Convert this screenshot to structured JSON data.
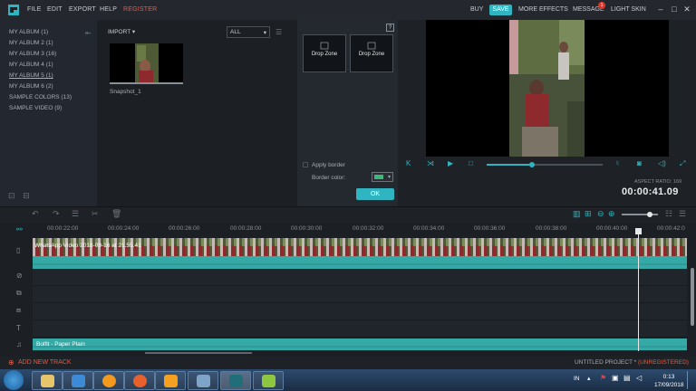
{
  "menu": {
    "file": "FILE",
    "edit": "EDIT",
    "export": "EXPORT",
    "help": "HELP",
    "register": "REGISTER",
    "buy": "BUY",
    "save": "SAVE",
    "more_effects": "MORE EFFECTS",
    "message": "MESSAGE",
    "message_count": "1",
    "light_skin": "LIGHT SKIN"
  },
  "library": {
    "albums": [
      {
        "label": "MY ALBUM (1)"
      },
      {
        "label": "MY ALBUM 2 (1)"
      },
      {
        "label": "MY ALBUM 3 (16)"
      },
      {
        "label": "MY ALBUM 4 (1)"
      },
      {
        "label": "MY ALBUM 5 (1)"
      },
      {
        "label": "MY ALBUM 6 (2)"
      },
      {
        "label": "SAMPLE COLORS (13)"
      },
      {
        "label": "SAMPLE VIDEO (9)"
      }
    ]
  },
  "media": {
    "import_label": "IMPORT",
    "filter_value": "ALL",
    "thumb_label": "Snapshot_1"
  },
  "transition": {
    "help": "?",
    "dropzone1": "Drop Zone",
    "dropzone2": "Drop Zone",
    "apply_border": "Apply border",
    "border_color_label": "Border color:",
    "border_color": "#3cb878",
    "ok": "OK"
  },
  "preview": {
    "aspect_ratio": "ASPECT RATIO: 169",
    "timecode": "00:00:41.09",
    "progress": 0.39
  },
  "timeline": {
    "ticks": [
      "00:00:22:00",
      "00:00:24:00",
      "00:00:26:00",
      "00:00:28:00",
      "00:00:30:00",
      "00:00:32:00",
      "00:00:34:00",
      "00:00:36:00",
      "00:00:38:00",
      "00:00:40:00",
      "00:00:42:0"
    ],
    "video_clip_label": "WhatsApp Video 2018-09-16 at 21.55.41",
    "music_clip_label": "Bolfit - Paper Plain"
  },
  "status": {
    "add_track": "ADD NEW TRACK",
    "project": "UNTITLED PROJECT *",
    "unregistered": "(UNREGISTERED)"
  },
  "taskbar": {
    "lang": "IN",
    "time": "0:13",
    "date": "17/09/2018"
  }
}
